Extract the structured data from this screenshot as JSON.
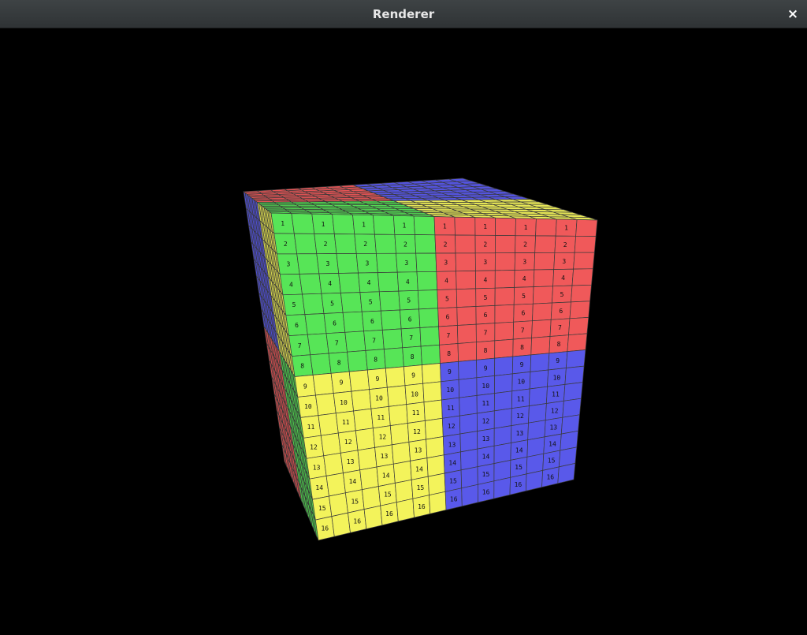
{
  "window": {
    "title": "Renderer",
    "close_glyph": "×"
  },
  "scene": {
    "object": "cube",
    "grid_per_face": 16,
    "palette": {
      "red": "#f0595a",
      "green": "#57e557",
      "blue": "#5959ea",
      "yellow": "#f3f35b",
      "grid_line": "#3a3a3a",
      "label": "#111111"
    },
    "faces": {
      "top": {
        "quadrants": [
          "red",
          "blue",
          "green",
          "yellow"
        ]
      },
      "left": {
        "quadrants": [
          "blue",
          "yellow",
          "red",
          "green"
        ]
      },
      "front": {
        "quadrants": [
          "green",
          "red",
          "yellow",
          "blue"
        ]
      }
    },
    "row_labels": [
      "1",
      "2",
      "3",
      "4",
      "5",
      "6",
      "7",
      "8",
      "9",
      "10",
      "11",
      "12",
      "13",
      "14",
      "15",
      "16"
    ]
  }
}
